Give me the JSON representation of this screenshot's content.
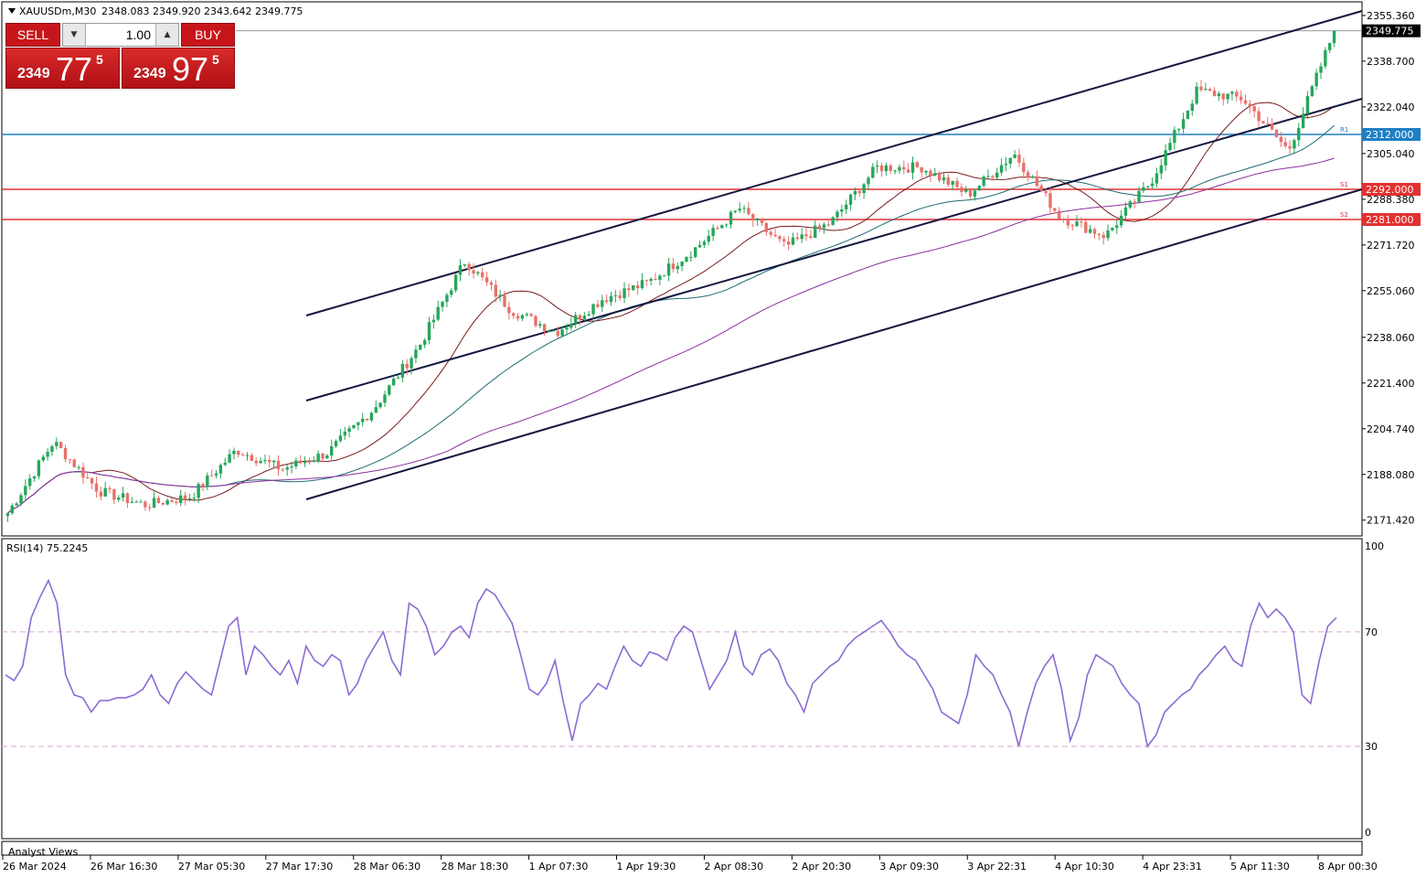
{
  "chart_header": {
    "title": "XAUUSDm,M30",
    "ohlc": "2348.083 2349.920 2343.642 2349.775"
  },
  "trade_panel": {
    "sell_label": "SELL",
    "buy_label": "BUY",
    "lot": "1.00",
    "sell_small": "2349",
    "sell_big": "77",
    "sell_sup": "5",
    "buy_small": "2349",
    "buy_big": "97",
    "buy_sup": "5",
    "lot_down_icon": "triangle-down-icon",
    "lot_up_icon": "triangle-up-icon"
  },
  "colors": {
    "bull": "#26a65b",
    "bear": "#e8716a",
    "channel": "#14163f",
    "blue_level": "#1f7fc4",
    "red_level": "#e23131",
    "ma_fast": "#7a1b1b",
    "ma_mid": "#1d6a72",
    "ma_slow": "#8b2fa0",
    "rsi": "#8c6bd4",
    "rsi_level": "#d6a6d6"
  },
  "price_axis_labels": [
    "2355.360",
    "2338.700",
    "2322.040",
    "2305.040",
    "2288.380",
    "2271.720",
    "2255.060",
    "2238.060",
    "2221.400",
    "2204.740",
    "2188.080",
    "2171.420"
  ],
  "current_price_label": "2349.775",
  "level_labels": {
    "blue": "2312.000",
    "red_top": "2292.000",
    "red_bottom": "2281.000"
  },
  "level_tags": {
    "blue": "R1",
    "red_top": "S1",
    "red_bottom": "S2"
  },
  "rsi": {
    "label": "RSI(14) 75.2245",
    "axis_labels": [
      "100",
      "70",
      "30",
      "0"
    ]
  },
  "time_axis_labels": [
    "26 Mar 2024",
    "26 Mar 16:30",
    "27 Mar 05:30",
    "27 Mar 17:30",
    "28 Mar 06:30",
    "28 Mar 18:30",
    "1 Apr 07:30",
    "1 Apr 19:30",
    "2 Apr 08:30",
    "2 Apr 20:30",
    "3 Apr 09:30",
    "3 Apr 22:31",
    "4 Apr 10:30",
    "4 Apr 23:31",
    "5 Apr 11:30",
    "8 Apr 00:30"
  ],
  "footer_label": "Analyst Views",
  "chart_data": [
    {
      "type": "candlestick",
      "symbol": "XAUUSDm",
      "timeframe": "M30",
      "ylim": [
        2166,
        2360
      ],
      "close_path": [
        [
          "26 Mar 2024",
          2174
        ],
        [
          "26 Mar 08:00",
          2200
        ],
        [
          "26 Mar 12:00",
          2182
        ],
        [
          "26 Mar 16:30",
          2177
        ],
        [
          "27 Mar 05:30",
          2180
        ],
        [
          "27 Mar 08:00",
          2197
        ],
        [
          "27 Mar 17:30",
          2190
        ],
        [
          "28 Mar 06:30",
          2196
        ],
        [
          "28 Mar 12:00",
          2212
        ],
        [
          "28 Mar 18:30",
          2235
        ],
        [
          "29 Mar 00:00",
          2266
        ],
        [
          "1 Apr 07:30",
          2248
        ],
        [
          "1 Apr 10:00",
          2240
        ],
        [
          "1 Apr 19:30",
          2252
        ],
        [
          "2 Apr 08:30",
          2258
        ],
        [
          "2 Apr 12:00",
          2270
        ],
        [
          "2 Apr 20:30",
          2285
        ],
        [
          "3 Apr 04:00",
          2271
        ],
        [
          "3 Apr 09:30",
          2280
        ],
        [
          "3 Apr 16:00",
          2300
        ],
        [
          "3 Apr 22:31",
          2300
        ],
        [
          "4 Apr 10:30",
          2290
        ],
        [
          "4 Apr 16:00",
          2305
        ],
        [
          "4 Apr 20:00",
          2282
        ],
        [
          "4 Apr 23:31",
          2275
        ],
        [
          "5 Apr 11:30",
          2295
        ],
        [
          "5 Apr 16:00",
          2328
        ],
        [
          "5 Apr 22:00",
          2325
        ],
        [
          "8 Apr 00:00",
          2306
        ],
        [
          "8 Apr 00:30",
          2349.775
        ]
      ]
    },
    {
      "type": "line",
      "name": "RSI(14)",
      "ylim": [
        0,
        100
      ],
      "levels": [
        70,
        30
      ],
      "last_value": 75.2245,
      "values": [
        55,
        53,
        58,
        75,
        82,
        88,
        80,
        55,
        48,
        47,
        42,
        46,
        46,
        47,
        47,
        48,
        50,
        55,
        48,
        45,
        52,
        56,
        53,
        50,
        48,
        60,
        72,
        75,
        55,
        65,
        62,
        58,
        55,
        60,
        52,
        65,
        60,
        58,
        62,
        60,
        48,
        52,
        60,
        65,
        70,
        60,
        55,
        80,
        78,
        72,
        62,
        65,
        70,
        72,
        68,
        80,
        85,
        83,
        78,
        73,
        62,
        50,
        48,
        52,
        60,
        45,
        32,
        45,
        48,
        52,
        50,
        58,
        65,
        60,
        58,
        63,
        62,
        60,
        68,
        72,
        70,
        60,
        50,
        55,
        60,
        70,
        58,
        55,
        62,
        64,
        60,
        52,
        48,
        42,
        52,
        55,
        58,
        60,
        65,
        68,
        70,
        72,
        74,
        70,
        65,
        62,
        60,
        55,
        50,
        42,
        40,
        38,
        48,
        62,
        58,
        55,
        48,
        42,
        30,
        42,
        52,
        58,
        62,
        50,
        32,
        40,
        55,
        62,
        60,
        58,
        52,
        48,
        45,
        30,
        34,
        42,
        45,
        48,
        50,
        55,
        58,
        62,
        65,
        60,
        58,
        72,
        80,
        75,
        78,
        75,
        70,
        48,
        45,
        60,
        72,
        75
      ]
    }
  ]
}
